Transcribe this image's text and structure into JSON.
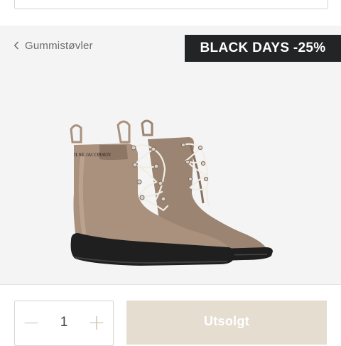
{
  "breadcrumb": {
    "label": "Gummistøvler",
    "icon": "chevron-left-icon"
  },
  "promo": {
    "label": "BLACK DAYS -25%"
  },
  "product": {
    "image_alt": "Ankle rubber boots",
    "brand_print": "ILSE JACOBSEN",
    "colors": {
      "boot": "#a9917e",
      "sole": "#222222",
      "laces": "#f1ede4"
    }
  },
  "purchase": {
    "quantity": "1",
    "minus_icon": "minus-icon",
    "plus_icon": "plus-icon",
    "button_label": "Utsolgt"
  },
  "colors": {
    "badge_bg": "#222426",
    "button_bg": "#e5ddd0",
    "image_bg": "#f4f4f4"
  }
}
